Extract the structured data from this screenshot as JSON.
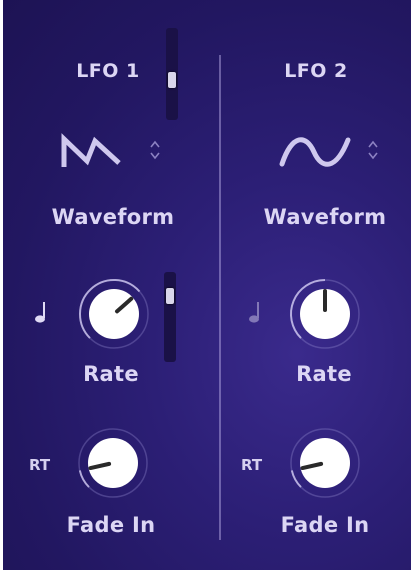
{
  "colors": {
    "background": "#261a6b",
    "text": "#dcd6f4",
    "knob_face": "#ffffff",
    "knob_indicator": "#2a2a2a",
    "glyph": "#cfc8ee"
  },
  "lfo1": {
    "title": "LFO 1",
    "waveform_icon": "sawtooth-wave-icon",
    "waveform_label": "Waveform",
    "rate_label": "Rate",
    "rate_unit_icon": "note-icon",
    "fade_in_label": "Fade In",
    "rt_label": "RT",
    "rate_level": 0.68,
    "fade_in_level": 0.12
  },
  "lfo2": {
    "title": "LFO 2",
    "waveform_icon": "sine-wave-icon",
    "waveform_label": "Waveform",
    "rate_label": "Rate",
    "rate_unit_icon": "note-icon",
    "fade_in_label": "Fade In",
    "rt_label": "RT",
    "rate_level": 0.5,
    "fade_in_level": 0.12
  }
}
